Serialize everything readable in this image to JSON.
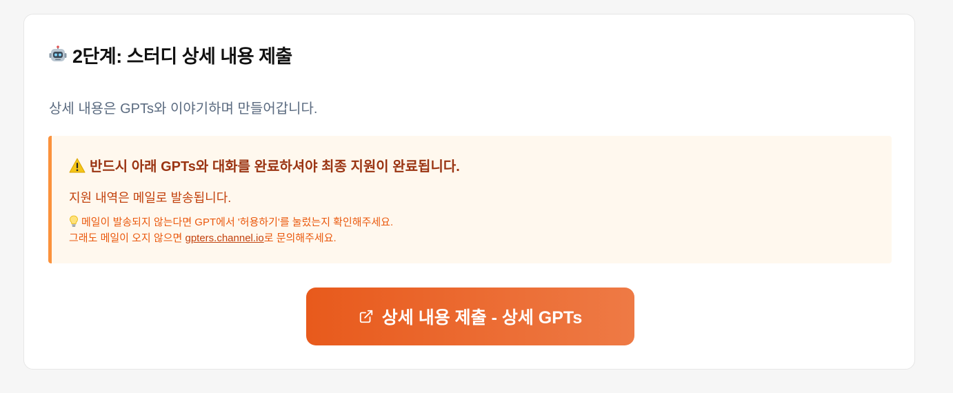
{
  "header": {
    "title": "2단계: 스터디 상세 내용 제출",
    "title_icon": "robot-icon",
    "subtitle": "상세 내용은 GPTs와 이야기하며 만들어갑니다."
  },
  "notice": {
    "icon": "warning-icon",
    "title": "반드시 아래 GPTs와 대화를 완료하셔야 최종 지원이 완료됩니다.",
    "line": "지원 내역은 메일로 발송됩니다.",
    "tip_icon": "lightbulb-icon",
    "tip_line1": "메일이 발송되지 않는다면 GPT에서 '허용하기'를 눌렀는지 확인해주세요.",
    "tip_line2_prefix": "그래도 메일이 오지 않으면 ",
    "tip_link": "gpters.channel.io",
    "tip_line2_suffix": "로 문의해주세요."
  },
  "cta": {
    "icon": "external-link-icon",
    "label": "상세 내용 제출 - 상세 GPTs"
  },
  "colors": {
    "accent_start": "#e85a1c",
    "accent_end": "#ee7a45",
    "notice_bg": "#fff8ee",
    "notice_border": "#fb923c",
    "notice_title": "#9a3412"
  }
}
